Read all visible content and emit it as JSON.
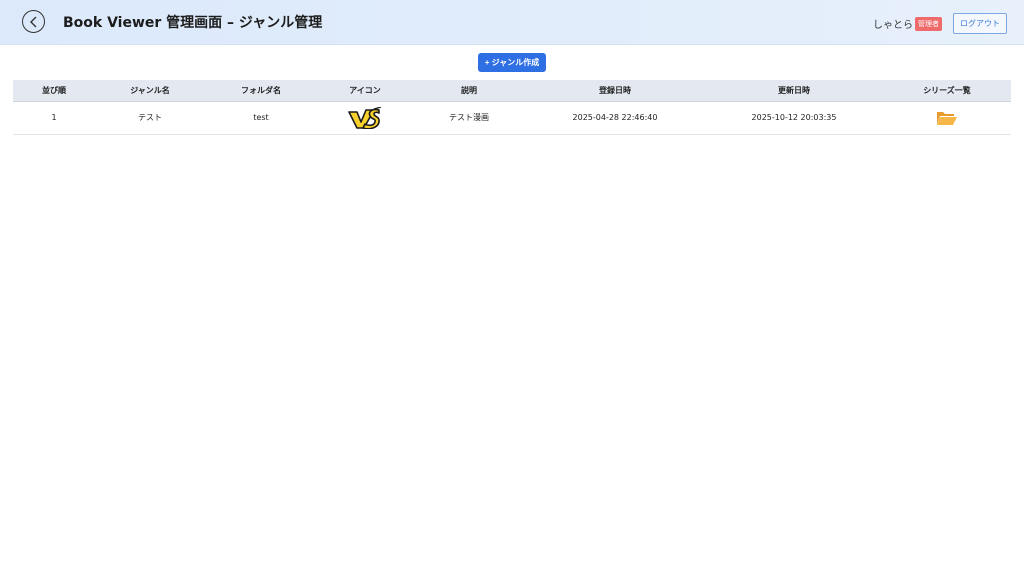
{
  "header": {
    "title": "Book Viewer 管理画面 – ジャンル管理",
    "username": "しゃとら",
    "role_badge": "管理者",
    "logout_label": "ログアウト"
  },
  "actions": {
    "create_label": "+ ジャンル作成"
  },
  "table": {
    "columns": [
      "並び順",
      "ジャンル名",
      "フォルダ名",
      "アイコン",
      "説明",
      "登録日時",
      "更新日時",
      "シリーズ一覧"
    ],
    "rows": [
      {
        "order": "1",
        "genre_name": "テスト",
        "folder_name": "test",
        "icon": "vs-icon",
        "description": "テスト漫画",
        "created_at": "2025-04-28 22:46:40",
        "updated_at": "2025-10-12 20:03:35",
        "series_icon": "folder-open-icon"
      }
    ]
  },
  "colors": {
    "header_bg": "#dbe9fb",
    "primary": "#2f6fe4",
    "badge": "#ef6b6b",
    "folder": "#f2a93b"
  }
}
